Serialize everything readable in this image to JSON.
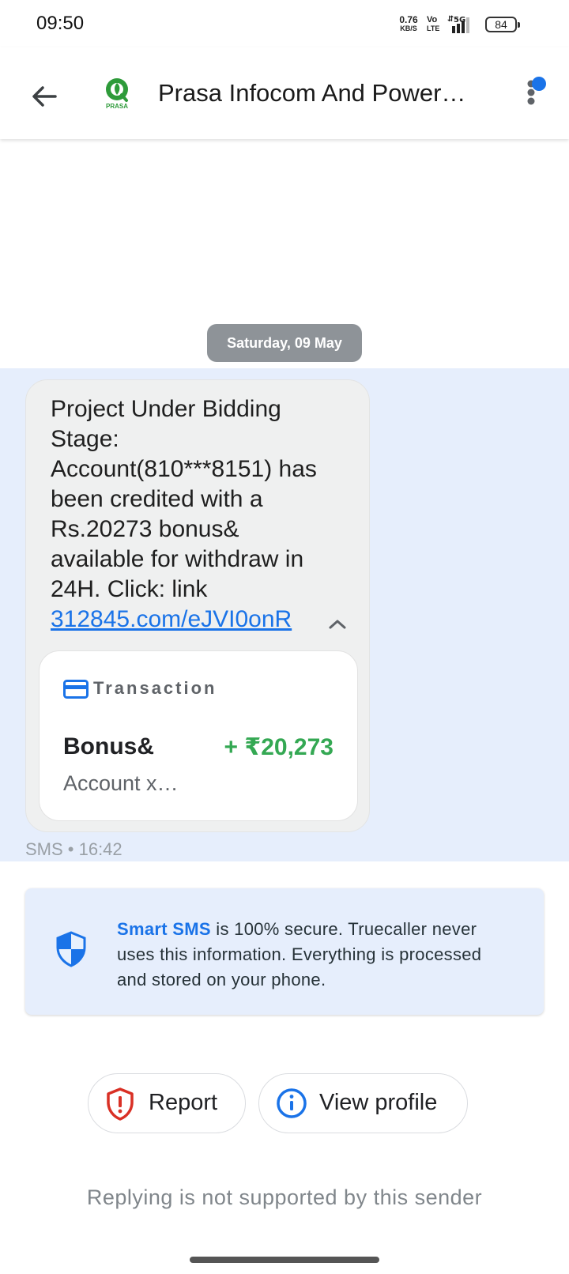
{
  "status_bar": {
    "time": "09:50",
    "speed_value": "0.76",
    "speed_unit": "KB/S",
    "volte_top": "Vo",
    "volte_bottom": "LTE",
    "network": "5G",
    "battery": "84"
  },
  "header": {
    "contact_name": "Prasa Infocom And Power…",
    "avatar_label": "PRASA",
    "notification_dot_color": "#1a73e8"
  },
  "conversation": {
    "date_chip": "Saturday, 09 May",
    "message": {
      "text": "Project Under Bidding Stage: Account(810***8151) has been credited with a Rs.20273 bonus& available for withdraw in 24H. Click: link",
      "link": "312845.com/eJVI0onR",
      "meta": "SMS • 16:42"
    },
    "transaction_card": {
      "title": "Transaction",
      "name": "Bonus&",
      "amount": "+ ₹20,273",
      "subtitle": "Account x…"
    }
  },
  "info_box": {
    "brand": "Smart SMS",
    "text": " is 100% secure. Truecaller never uses this information. Everything is processed and stored on your phone."
  },
  "actions": {
    "report_label": "Report",
    "view_profile_label": "View profile"
  },
  "reply_note": "Replying is not supported by this sender",
  "colors": {
    "accent": "#1a73e8",
    "amount_green": "#34a853",
    "report_red": "#d93025",
    "highlight": "#e6eefc"
  }
}
